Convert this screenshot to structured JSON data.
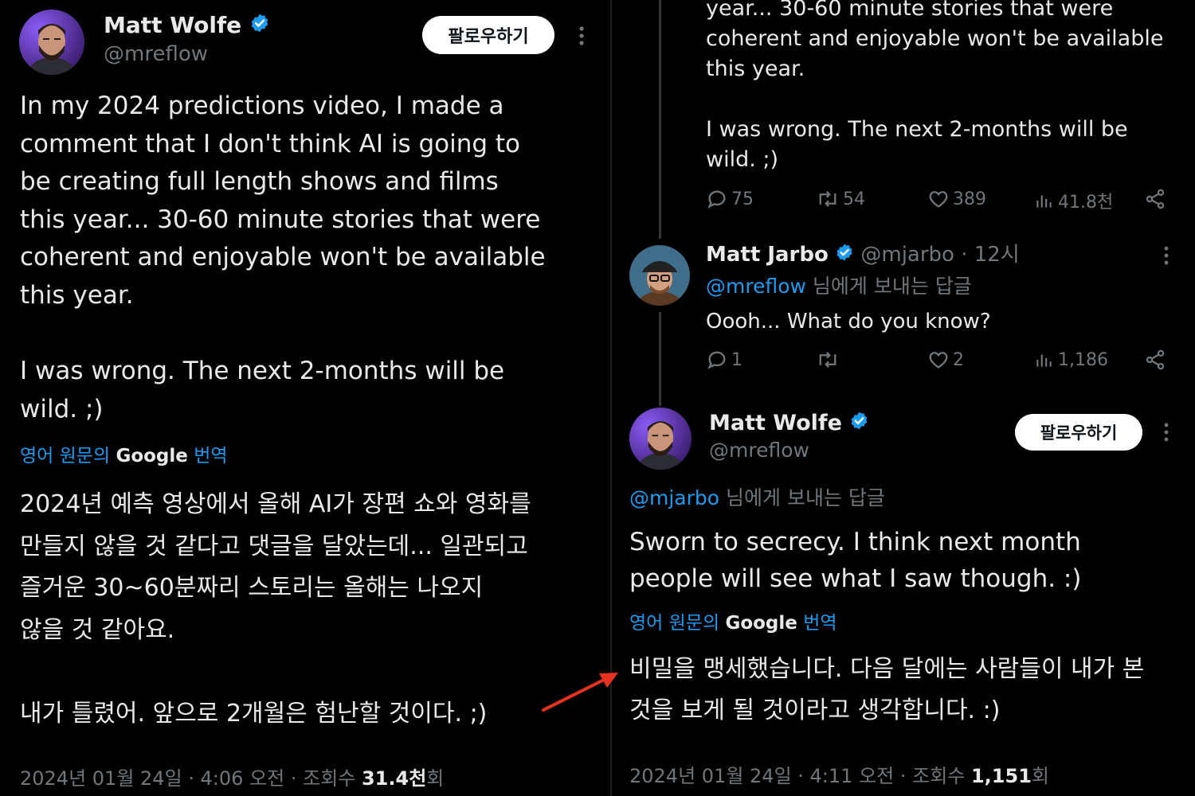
{
  "left_tweet": {
    "author_name": "Matt Wolfe",
    "handle": "@mreflow",
    "follow_label": "팔로우하기",
    "text": "In my 2024 predictions video, I made a\ncomment that I don't think AI is going to\nbe creating full length shows and films\nthis year... 30-60 minute stories that were\ncoherent and enjoyable won't be available\nthis year.\n\nI was wrong. The next 2-months will be\nwild. ;)",
    "translate_prefix": "영어 원문의",
    "translate_google": "Google",
    "translate_suffix": "번역",
    "translated_text": "2024년 예측 영상에서 올해 AI가 장편 쇼와 영화를\n만들지 않을 것 같다고 댓글을 달았는데... 일관되고\n즐거운 30~60분짜리 스토리는 올해는 나오지\n않을 것 같아요.\n\n내가 틀렸어. 앞으로 2개월은 험난할 것이다. ;)",
    "meta_date": "2024년 01월 24일 · 4:06 오전 · 조회수 ",
    "meta_views": "31.4천",
    "meta_views_suffix": "회"
  },
  "right_top_tweet": {
    "text": "year... 30-60 minute stories that were\ncoherent and enjoyable won't be available\nthis year.\n\nI was wrong. The next 2-months will be\nwild. ;)",
    "replies": "75",
    "retweets": "54",
    "likes": "389",
    "views": "41.8천"
  },
  "reply_tweet": {
    "author_name": "Matt Jarbo",
    "handle_time": "@mjarbo · 12시",
    "reply_to_handle": "@mreflow",
    "reply_to_suffix": " 님에게 보내는 답글",
    "text": "Oooh... What do you know?",
    "replies": "1",
    "retweets": "",
    "likes": "2",
    "views": "1,186"
  },
  "focus_tweet": {
    "author_name": "Matt Wolfe",
    "handle": "@mreflow",
    "follow_label": "팔로우하기",
    "reply_to_handle": "@mjarbo",
    "reply_to_suffix": " 님에게 보내는 답글",
    "text": "Sworn to secrecy. I think next month\npeople will see what I saw though. :)",
    "translate_prefix": "영어 원문의",
    "translate_google": "Google",
    "translate_suffix": "번역",
    "translated_text": "비밀을 맹세했습니다. 다음 달에는 사람들이 내가 본\n것을 보게 될 것이라고 생각합니다. :)",
    "meta_date": "2024년 01월 24일 · 4:11 오전 · 조회수 ",
    "meta_views": "1,151",
    "meta_views_suffix": "회"
  },
  "colors": {
    "background": "#000000",
    "text": "#e7e9ea",
    "muted": "#71767b",
    "link": "#1d9bf0",
    "verified": "#1d9bf0",
    "annotation_arrow": "#e8321e"
  },
  "icons": [
    "verified-badge-icon",
    "more-icon",
    "reply-icon",
    "retweet-icon",
    "like-icon",
    "views-icon",
    "share-icon",
    "annotation-arrow"
  ]
}
